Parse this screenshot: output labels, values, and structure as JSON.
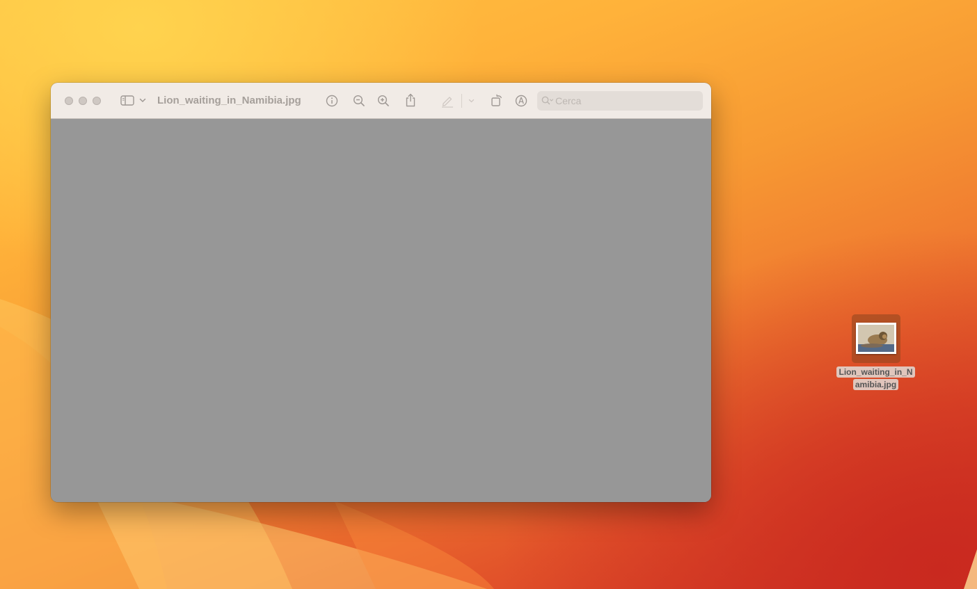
{
  "window": {
    "title": "Lion_waiting_in_Namibia.jpg",
    "search_placeholder": "Cerca",
    "toolbar_icons": [
      "sidebar-toggle-icon",
      "chevron-down-icon",
      "info-icon",
      "zoom-out-icon",
      "zoom-in-icon",
      "share-icon",
      "markup-pen-icon",
      "chevron-down-icon",
      "rotate-icon",
      "markup-circle-icon",
      "search-icon"
    ]
  },
  "desktop": {
    "file": {
      "name_line1": "Lion_waiting_in_N",
      "name_line2": "amibia.jpg"
    }
  },
  "colors": {
    "titlebar": "#f1ebe6",
    "content_bg": "#979797",
    "icon_gray": "#9e9894"
  }
}
